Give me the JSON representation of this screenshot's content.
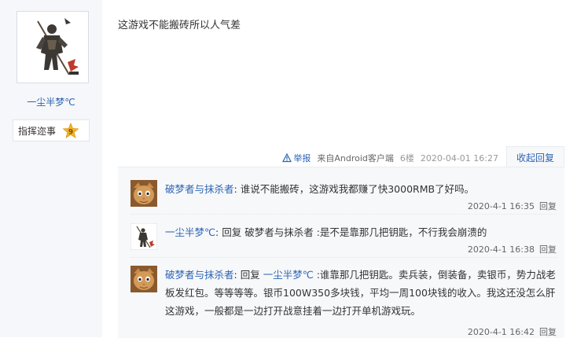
{
  "author": {
    "name": "一尘半梦℃",
    "level_title": "指挥迩事",
    "level_num": "9"
  },
  "post": {
    "content": "这游戏不能搬砖所以人气差"
  },
  "tail": {
    "report": "举报",
    "source": "来自Android客户端",
    "floor": "6楼",
    "time": "2020-04-01 16:27",
    "collapse": "收起回复"
  },
  "replies": [
    {
      "user": "破梦者与抹杀者",
      "colon": ":",
      "prefix": "",
      "target": "",
      "text": " 谁说不能搬砖，这游戏我都赚了快3000RMB了好吗。",
      "time": "2020-4-1 16:35",
      "reply_label": "回复",
      "avatar": "cat-avatar-icon"
    },
    {
      "user": "一尘半梦℃",
      "colon": ":",
      "prefix": " 回复 ",
      "target": "破梦者与抹杀者",
      "text": " :是不是靠那几把钥匙，不行我会崩溃的",
      "time": "2020-4-1 16:38",
      "reply_label": "回复",
      "avatar": "warrior-avatar-icon"
    },
    {
      "user": "破梦者与抹杀者",
      "colon": ":",
      "prefix": " 回复 ",
      "target": "一尘半梦℃",
      "text": " :谁靠那几把钥匙。卖兵装，倒装备，卖银币，势力战老板发红包。等等等等。银币100W350多块钱，平均一周100块钱的收入。我这还没怎么肝这游戏，一般都是一边打开战意挂着一边打开单机游戏玩。",
      "time": "2020-4-1 16:42",
      "reply_label": "回复",
      "avatar": "cat-avatar-icon"
    }
  ],
  "colors": {
    "link": "#2d64b3",
    "sidebar": "#f5f7fa",
    "reply_bg": "#f7f8fa"
  }
}
